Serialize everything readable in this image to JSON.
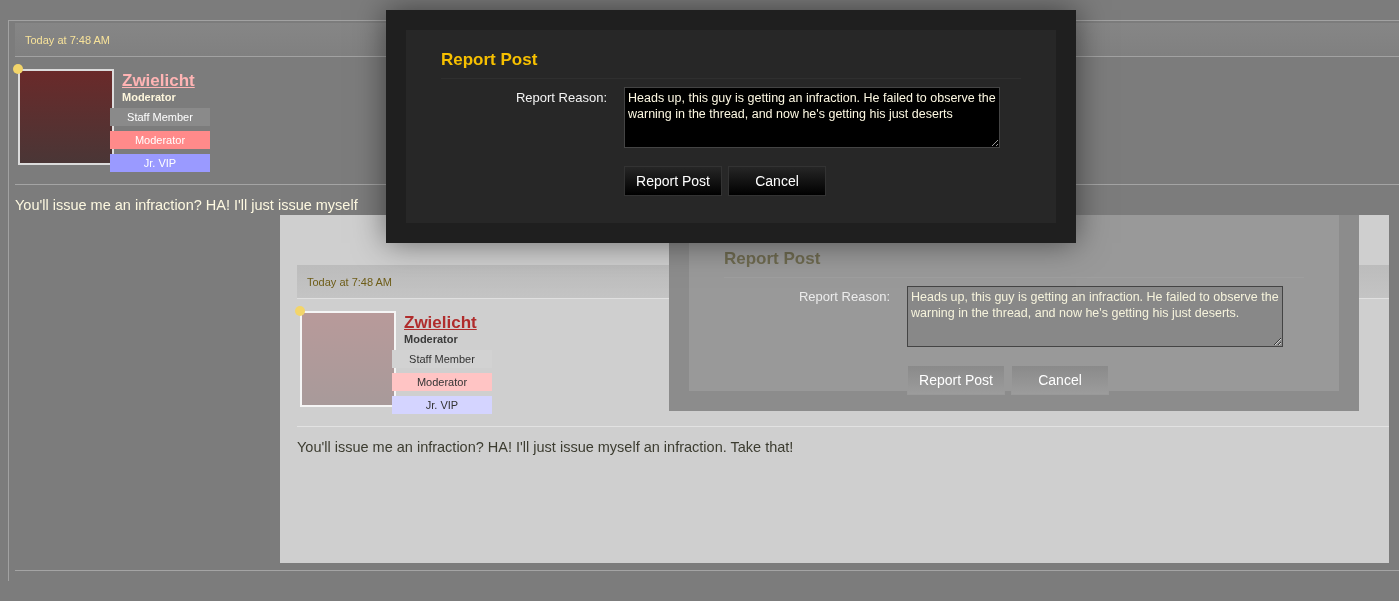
{
  "post": {
    "timestamp": "Today at 7:48 AM",
    "author": {
      "name": "Zwielicht",
      "title": "Moderator",
      "online": true,
      "banners": [
        {
          "label": "Staff Member",
          "color": "#8a8a8a"
        },
        {
          "label": "Moderator",
          "color": "#ff8a8a"
        },
        {
          "label": "Jr. VIP",
          "color": "#9a9aff"
        }
      ]
    },
    "message": "You'll issue me an infraction? HA! I'll just issue myself",
    "embedded_screenshot": {
      "post": {
        "timestamp": "Today at 7:48 AM",
        "author": {
          "name": "Zwielicht",
          "title": "Moderator",
          "online": true,
          "banners": [
            {
              "label": "Staff Member",
              "color": "#d2d2d2"
            },
            {
              "label": "Moderator",
              "color": "#ffc4c4"
            },
            {
              "label": "Jr. VIP",
              "color": "#d4d4ff"
            }
          ]
        },
        "message": "You'll issue me an infraction? HA! I'll just issue myself an infraction. Take that!"
      },
      "dialog": {
        "title": "Report Post",
        "field_label": "Report Reason:",
        "value": "Heads up, this guy is getting an infraction. He failed to observe the warning in the thread, and now he's getting his just deserts.",
        "buttons": [
          "Report Post",
          "Cancel"
        ]
      }
    }
  },
  "dialog": {
    "title": "Report Post",
    "field_label": "Report Reason:",
    "value": "Heads up, this guy is getting an infraction. He failed to observe the warning in the thread, and now he's getting his just deserts",
    "buttons": [
      "Report Post",
      "Cancel"
    ]
  }
}
